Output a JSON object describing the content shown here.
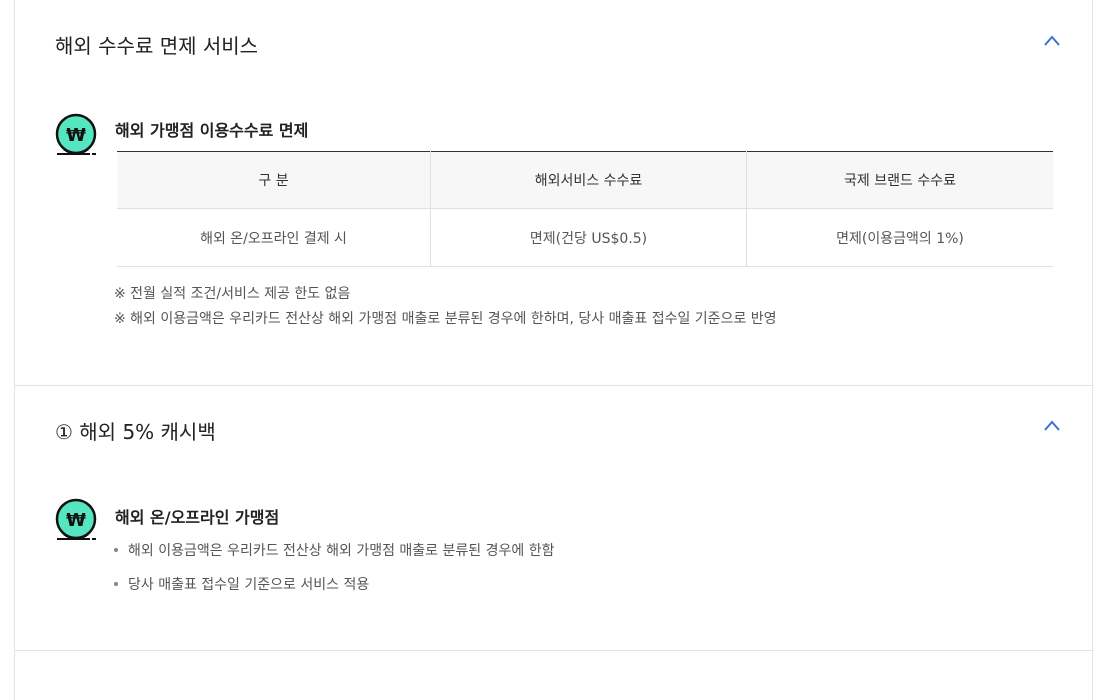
{
  "section1": {
    "title": "해외 수수료 면제 서비스",
    "toggle_icon": "chevron-up-icon",
    "subtitle": "해외 가맹점 이용수수료 면제",
    "coin_icon": "won-coin-icon",
    "table": {
      "headers": [
        "구 분",
        "해외서비스 수수료",
        "국제 브랜드 수수료"
      ],
      "rows": [
        [
          "해외 온/오프라인 결제 시",
          "면제(건당 US$0.5)",
          "면제(이용금액의 1%)"
        ]
      ]
    },
    "notes": [
      "※ 전월 실적 조건/서비스 제공 한도 없음",
      "※ 해외 이용금액은 우리카드 전산상 해외 가맹점 매출로 분류된 경우에 한하며, 당사 매출표 접수일 기준으로 반영"
    ]
  },
  "section2": {
    "title": "① 해외 5% 캐시백",
    "toggle_icon": "chevron-up-icon",
    "subtitle": "해외 온/오프라인 가맹점",
    "coin_icon": "won-coin-icon",
    "bullets": [
      "해외 이용금액은 우리카드 전산상 해외 가맹점 매출로 분류된 경우에 한함",
      "당사 매출표 접수일 기준으로 서비스 적용"
    ]
  },
  "colors": {
    "accent": "#3f6fd1",
    "coin": "#55e6c1",
    "border": "#e3e3e3"
  }
}
